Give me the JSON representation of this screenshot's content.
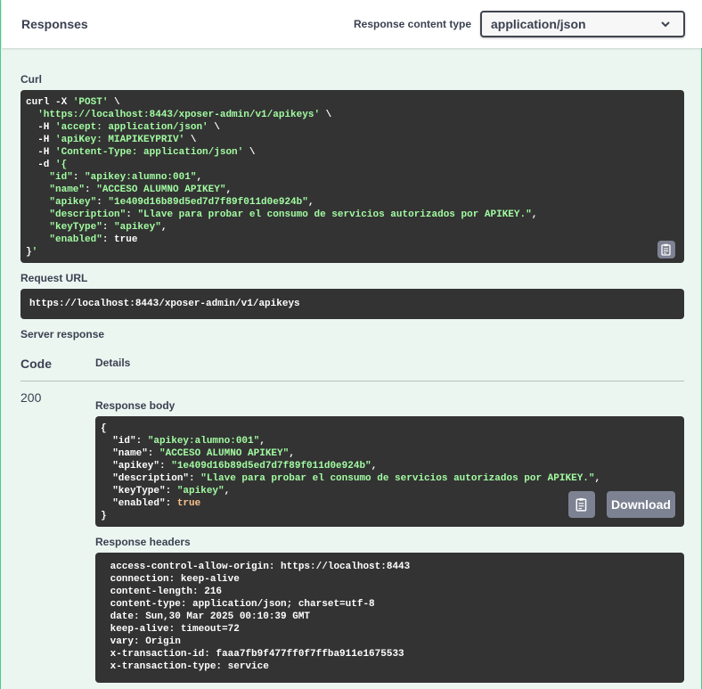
{
  "responses": {
    "title": "Responses",
    "content_type_label": "Response content type",
    "content_type_value": "application/json"
  },
  "curl": {
    "label": "Curl",
    "lines": [
      "curl -X 'POST' \\",
      "  'https://localhost:8443/xposer-admin/v1/apikeys' \\",
      "  -H 'accept: application/json' \\",
      "  -H 'apiKey: MIAPIKEYPRIV' \\",
      "  -H 'Content-Type: application/json' \\",
      "  -d '{",
      "    \"id\": \"apikey:alumno:001\",",
      "    \"name\": \"ACCESO ALUMNO APIKEY\",",
      "    \"apikey\": \"1e409d16b89d5ed7d7f89f011d0e924b\",",
      "    \"description\": \"Llave para probar el consumo de servicios autorizados por APIKEY.\",",
      "    \"keyType\": \"apikey\",",
      "    \"enabled\": true",
      "}'"
    ]
  },
  "request_url": {
    "label": "Request URL",
    "value": "https://localhost:8443/xposer-admin/v1/apikeys"
  },
  "server_response": {
    "label": "Server response",
    "col_code": "Code",
    "col_details": "Details",
    "code": "200",
    "body_label": "Response body",
    "body_lines": [
      "{",
      "  \"id\": \"apikey:alumno:001\",",
      "  \"name\": \"ACCESO ALUMNO APIKEY\",",
      "  \"apikey\": \"1e409d16b89d5ed7d7f89f011d0e924b\",",
      "  \"description\": \"Llave para probar el consumo de servicios autorizados por APIKEY.\",",
      "  \"keyType\": \"apikey\",",
      "  \"enabled\": true",
      "}"
    ],
    "download_label": "Download",
    "headers_label": "Response headers",
    "headers_lines": [
      " access-control-allow-origin: https://localhost:8443 ",
      " connection: keep-alive ",
      " content-length: 216 ",
      " content-type: application/json; charset=utf-8 ",
      " date: Sun,30 Mar 2025 00:10:39 GMT ",
      " keep-alive: timeout=72 ",
      " vary: Origin ",
      " x-transaction-id: faaa7fb9f477ff0f7ffba911e1675533 ",
      " x-transaction-type: service "
    ]
  },
  "icons": {
    "copy": "clipboard-copy-icon",
    "chevron": "chevron-down-icon"
  },
  "colors": {
    "accent": "#49cc90",
    "panel_bg": "#ebf6f1",
    "code_bg": "#333333",
    "code_string": "#a2fca2",
    "code_keyword": "#fcc28c",
    "button_bg": "#7d8293"
  }
}
